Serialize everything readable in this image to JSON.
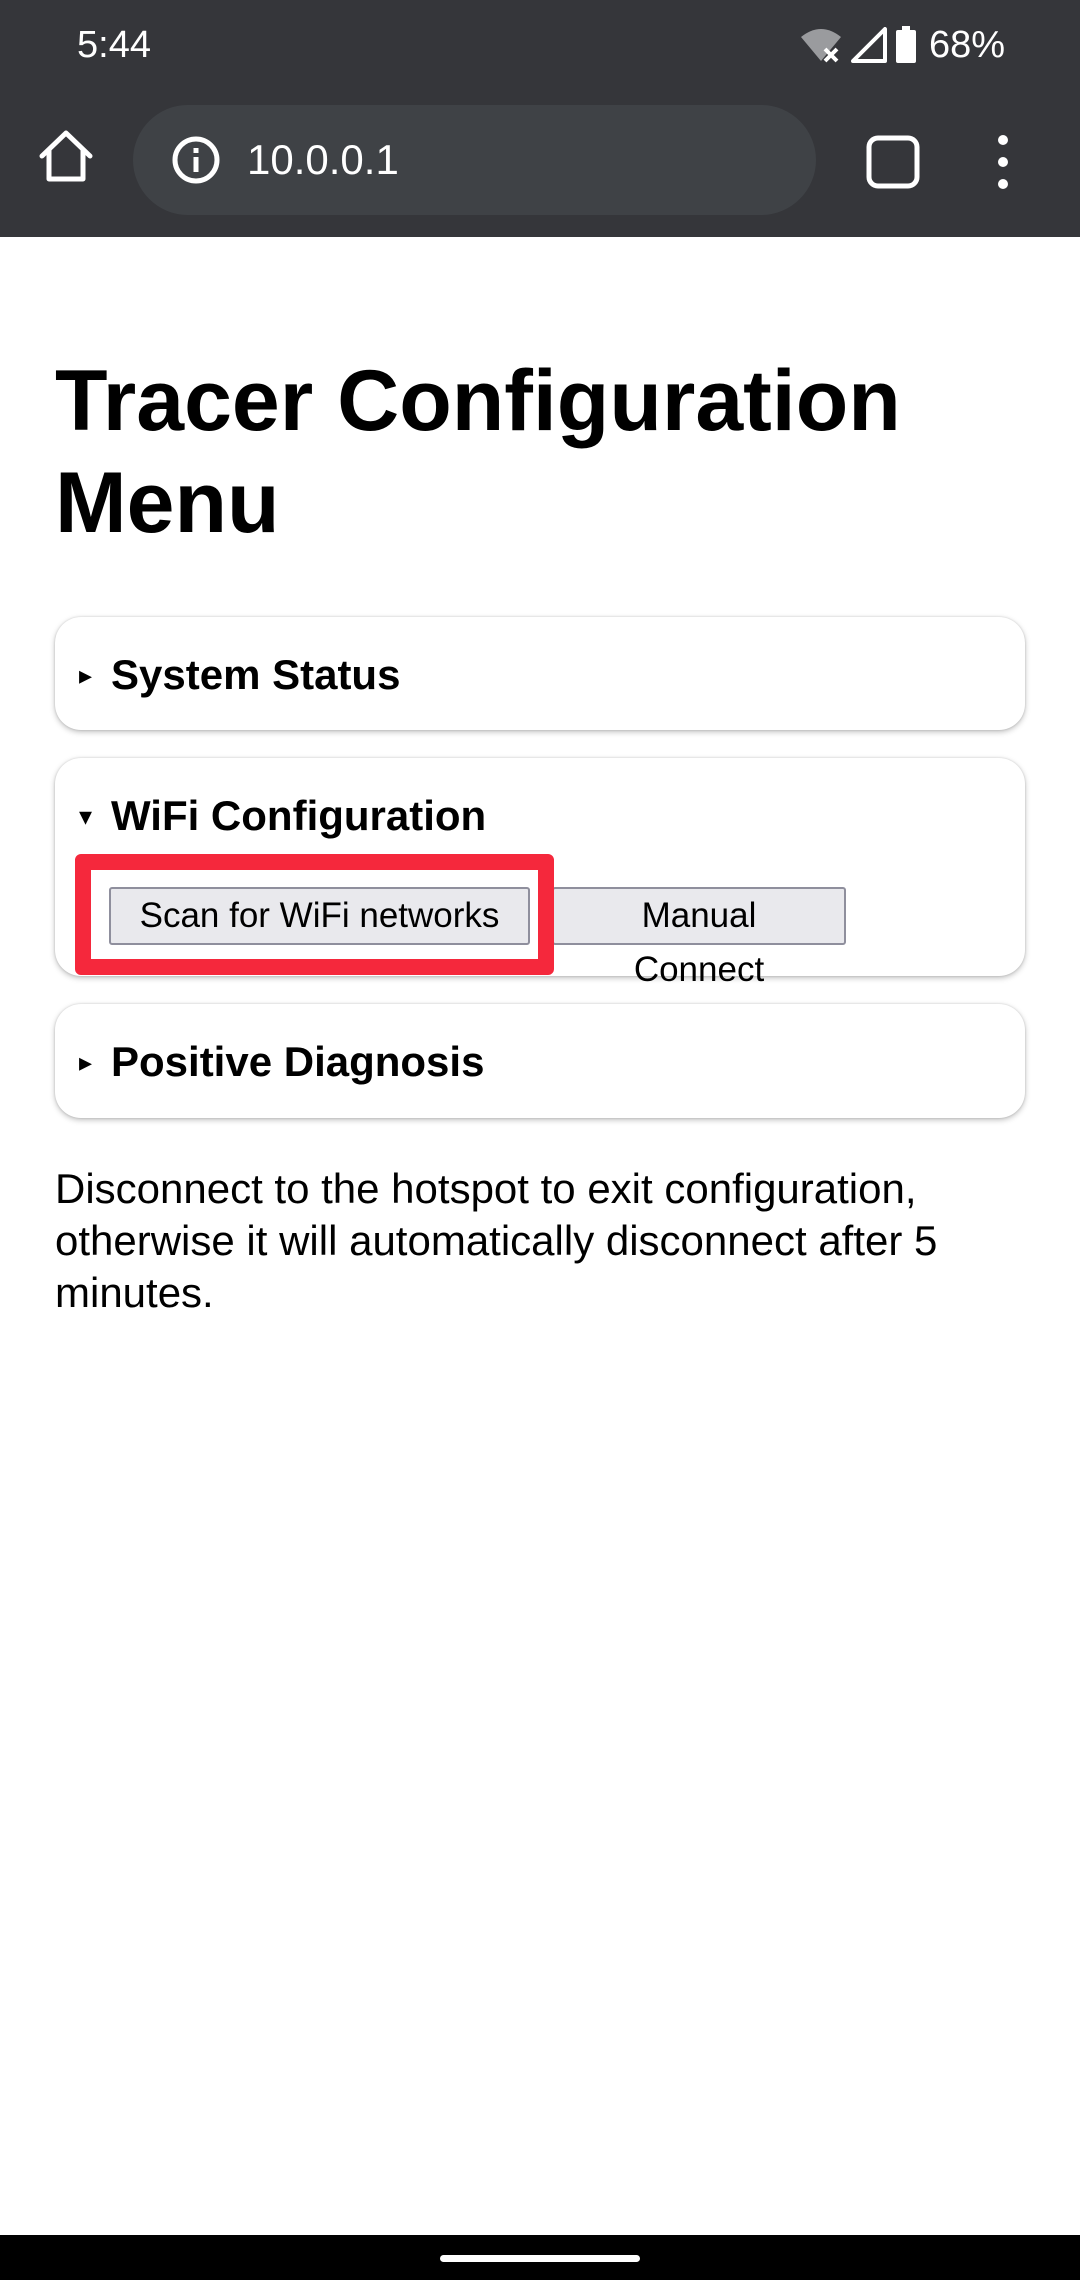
{
  "status_bar": {
    "time": "5:44",
    "battery_percent": "68%",
    "icons": [
      "wifi-no-internet-icon",
      "cell-signal-icon",
      "battery-icon"
    ]
  },
  "toolbar": {
    "url": "10.0.0.1",
    "icons": [
      "home-icon",
      "info-icon",
      "tab-switcher-icon",
      "more-vert-icon"
    ]
  },
  "page": {
    "title": "Tracer Configuration Menu",
    "sections": [
      {
        "marker": "▸",
        "label": "System Status",
        "expanded": false
      },
      {
        "marker": "▾",
        "label": "WiFi Configuration",
        "expanded": true
      },
      {
        "marker": "▸",
        "label": "Positive Diagnosis",
        "expanded": false
      }
    ],
    "wifi_buttons": {
      "scan": "Scan for WiFi networks",
      "manual": "Manual Connect"
    },
    "note": "Disconnect to the hotspot to exit configuration, otherwise it will automatically disconnect after 5 minutes."
  },
  "colors": {
    "chrome_bar": "#35363a",
    "omnibox": "#3f4246",
    "highlight": "#f5283c",
    "button_bg": "#e9e9ed"
  }
}
